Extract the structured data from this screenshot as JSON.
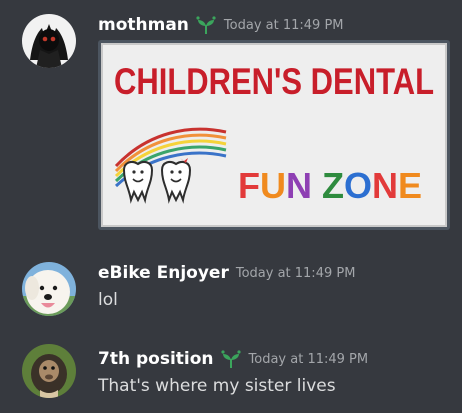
{
  "messages": [
    {
      "username": "mothman",
      "timestamp": "Today at 11:49 PM",
      "badge_icon": "sprout-icon",
      "avatar_icon": "dark-creature-avatar",
      "attachment": {
        "line1": "CHILDREN'S DENTAL",
        "line2_words": [
          "FUN",
          "ZONE"
        ],
        "line2_letter_colors": [
          "#e23a3a",
          "#f08a1e",
          "#8e3fb3",
          "#2e8b3e",
          "#2c6fd1",
          "#e23a3a",
          "#f08a1e"
        ]
      }
    },
    {
      "username": "eBike Enjoyer",
      "timestamp": "Today at 11:49 PM",
      "text": "lol",
      "avatar_icon": "white-dog-avatar"
    },
    {
      "username": "7th position",
      "timestamp": "Today at 11:49 PM",
      "text": "That's where my sister lives",
      "badge_icon": "sprout-icon",
      "avatar_icon": "monkey-avatar"
    }
  ],
  "colors": {
    "background": "#36393f",
    "username": "#ffffff",
    "timestamp": "#a3a6aa",
    "text": "#dcddde",
    "badge": "#3ba55c"
  }
}
